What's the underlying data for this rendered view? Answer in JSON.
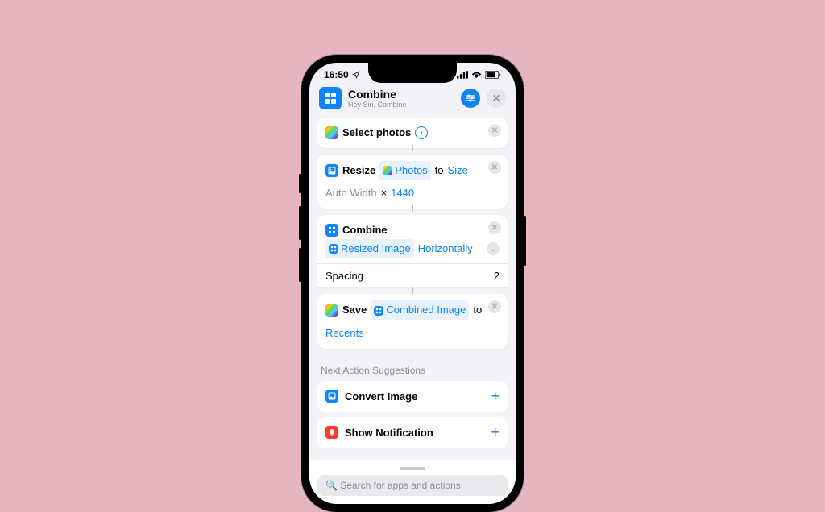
{
  "status": {
    "time": "16:50"
  },
  "header": {
    "title": "Combine",
    "subtitle": "Hey Siri, Combine"
  },
  "actions": {
    "select": {
      "label": "Select photos"
    },
    "resize": {
      "label": "Resize",
      "input": "Photos",
      "to": "to",
      "size": "Size",
      "width": "Auto Width",
      "sep": "×",
      "height": "1440"
    },
    "combine": {
      "label": "Combine",
      "input": "Resized Image",
      "mode": "Horizontally",
      "spacing_label": "Spacing",
      "spacing_value": "2"
    },
    "save": {
      "label": "Save",
      "input": "Combined Image",
      "to": "to",
      "dest": "Recents"
    }
  },
  "suggestions_label": "Next Action Suggestions",
  "suggestions": [
    {
      "label": "Convert Image"
    },
    {
      "label": "Show Notification"
    }
  ],
  "search": {
    "placeholder": "Search for apps and actions"
  }
}
